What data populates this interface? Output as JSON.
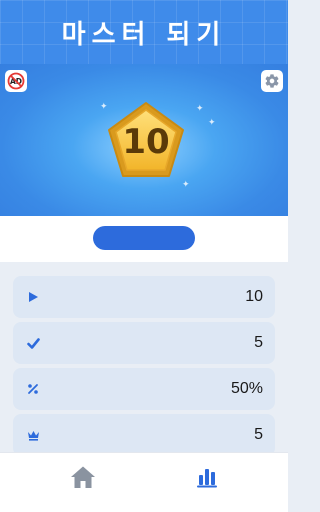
{
  "header": {
    "title": "마스터 되기"
  },
  "hero": {
    "level": "10",
    "noads_label": "AD"
  },
  "stats": [
    {
      "icon": "play-icon",
      "value": "10"
    },
    {
      "icon": "check-icon",
      "value": "5"
    },
    {
      "icon": "percent-icon",
      "value": "50%"
    },
    {
      "icon": "crown-icon",
      "value": "5"
    }
  ],
  "nav": [
    {
      "icon": "home-icon",
      "active": false
    },
    {
      "icon": "stats-icon",
      "active": true
    }
  ],
  "colors": {
    "accent": "#2d6bdc",
    "header": "#3f8bea",
    "badge_gold": "#f5c23a",
    "row_bg": "#dde7f4"
  }
}
